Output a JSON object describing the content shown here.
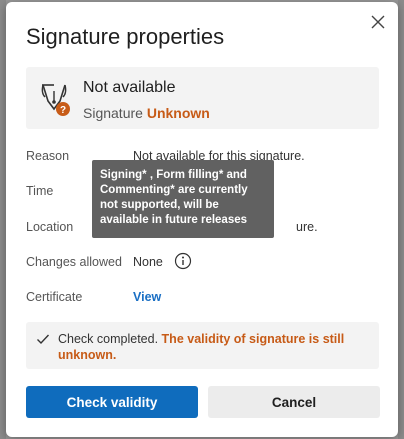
{
  "dialog": {
    "title": "Signature properties",
    "close_icon": "close-icon"
  },
  "status": {
    "icon": "pen-nib-icon",
    "badge_icon": "question-badge-icon",
    "title": "Not available",
    "subtitle_prefix": "Signature",
    "subtitle_value": "Unknown",
    "accent_color": "#c75b17"
  },
  "details": {
    "reason": {
      "label": "Reason",
      "value": "Not available for this signature."
    },
    "time": {
      "label": "Time",
      "value": ""
    },
    "location": {
      "label": "Location",
      "value": "ure."
    },
    "changes_allowed": {
      "label": "Changes allowed",
      "value": "None",
      "icon": "info-icon"
    },
    "certificate": {
      "label": "Certificate",
      "link": "View"
    }
  },
  "tooltip": {
    "text": "Signing* , Form filling* and Commenting* are currently not supported, will be available in future releases"
  },
  "check": {
    "icon": "checkmark-icon",
    "text": "Check completed.",
    "warning": "The validity of signature is still unknown."
  },
  "buttons": {
    "primary": "Check validity",
    "secondary": "Cancel",
    "primary_color": "#0f6cbd"
  }
}
